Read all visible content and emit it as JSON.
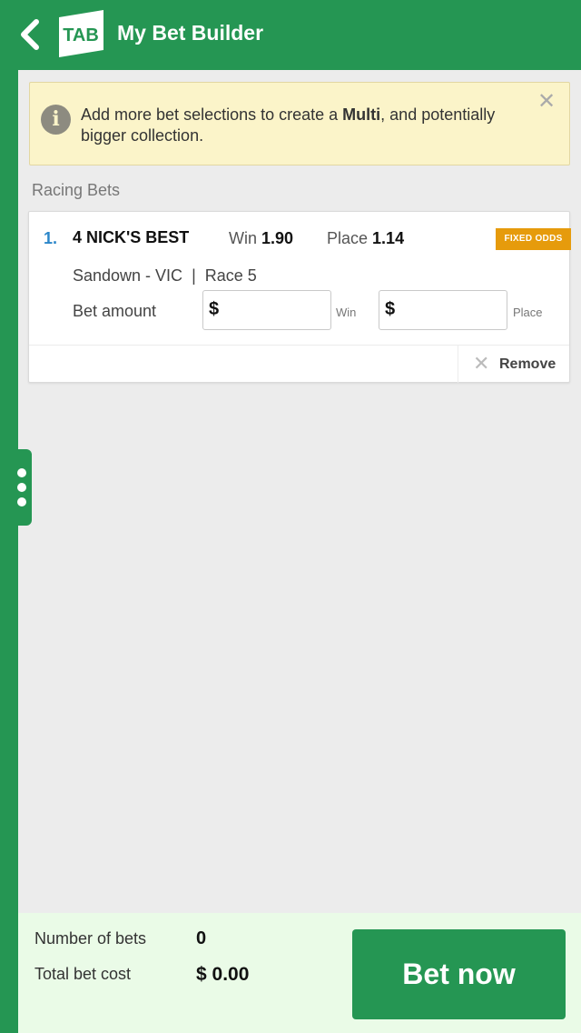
{
  "header": {
    "title": "My Bet Builder",
    "logo_text": "TAB",
    "brand_color": "#259653"
  },
  "info_banner": {
    "text_before": "Add more bet selections to create a ",
    "text_bold": "Multi",
    "text_after": ", and potentially bigger collection.",
    "icon": "info-icon",
    "close_icon": "close-icon"
  },
  "section": {
    "label": "Racing Bets"
  },
  "bets": [
    {
      "index": "1.",
      "runner": "4 NICK'S BEST",
      "win_label": "Win",
      "win_odds": "1.90",
      "place_label": "Place",
      "place_odds": "1.14",
      "badge": "FIXED ODDS",
      "venue": "Sandown - VIC",
      "separator": "|",
      "race": "Race 5",
      "amount_label": "Bet amount",
      "win_currency": "$",
      "win_hint": "Win",
      "place_currency": "$",
      "place_hint": "Place",
      "remove_label": "Remove"
    }
  ],
  "footer": {
    "bets_label": "Number of bets",
    "bets_value": "0",
    "cost_label": "Total bet cost",
    "cost_value": "$ 0.00",
    "cta_label": "Bet now"
  },
  "colors": {
    "accent_orange": "#e69b0c",
    "link_blue": "#2b86c9",
    "banner_bg": "#fbf4c9",
    "footer_bg": "#eafbe7"
  }
}
